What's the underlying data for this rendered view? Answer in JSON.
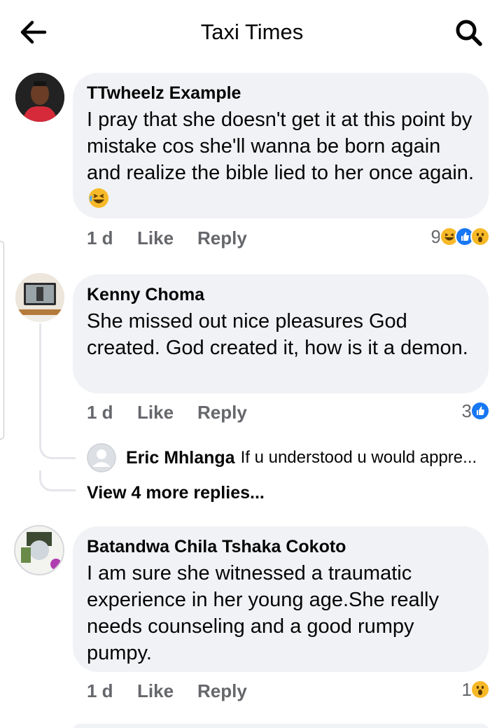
{
  "header": {
    "title": "Taxi Times",
    "back_icon": "arrow-left-icon",
    "search_icon": "search-icon"
  },
  "comments": [
    {
      "author": "TTwheelz Example",
      "text": "I pray that she doesn't get it at this point by mistake cos she'll wanna be born again and realize the bible lied to her once again.",
      "time": "1 d",
      "like_label": "Like",
      "reply_label": "Reply",
      "reaction_count": "9",
      "reactions": [
        "haha",
        "like",
        "wow"
      ]
    },
    {
      "author": "Kenny Choma",
      "text": "She missed out nice pleasures God created. God created it, how is it a demon.",
      "time": "1 d",
      "like_label": "Like",
      "reply_label": "Reply",
      "reaction_count": "3",
      "reactions": [
        "like"
      ],
      "reply_preview": {
        "author": "Eric Mhlanga",
        "text": "If u understood u would appre..."
      },
      "view_more": "View 4 more replies..."
    },
    {
      "author": "Batandwa Chila Tshaka Cokoto",
      "text": "I am sure she witnessed a traumatic experience in her young age.She really needs counseling and a good rumpy pumpy.",
      "time": "1 d",
      "like_label": "Like",
      "reply_label": "Reply",
      "reaction_count": "1",
      "reactions": [
        "wow"
      ]
    }
  ],
  "colors": {
    "bubble": "#f0f2f5",
    "secondary_text": "#65676b",
    "like_blue": "#1877f2",
    "emoji_yellow": "#f7b928"
  }
}
